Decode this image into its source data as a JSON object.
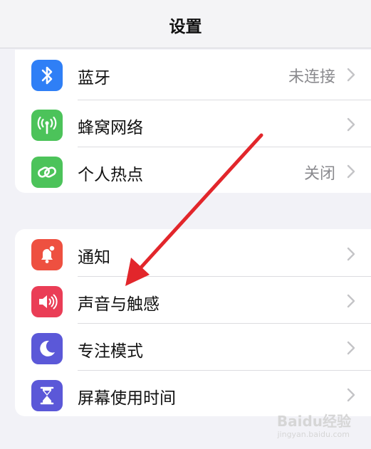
{
  "nav": {
    "title": "设置"
  },
  "group1": [
    {
      "label": "蓝牙",
      "value": "未连接",
      "icon": "bluetooth-icon",
      "color": "#2f7ff6"
    },
    {
      "label": "蜂窝网络",
      "value": "",
      "icon": "antenna-icon",
      "color": "#4cc35a"
    },
    {
      "label": "个人热点",
      "value": "关闭",
      "icon": "hotspot-link-icon",
      "color": "#4cc35a"
    }
  ],
  "group2": [
    {
      "label": "通知",
      "icon": "notification-bell-icon",
      "color": "#ee5040"
    },
    {
      "label": "声音与触感",
      "icon": "speaker-icon",
      "color": "#ea3d56"
    },
    {
      "label": "专注模式",
      "icon": "moon-icon",
      "color": "#5b58d8"
    },
    {
      "label": "屏幕使用时间",
      "icon": "hourglass-icon",
      "color": "#5b58d8"
    }
  ],
  "annotation": {
    "arrow_color": "#e2262b"
  },
  "watermark": {
    "text": "Baidu经验",
    "sub": "jingyan.baidu.com"
  }
}
